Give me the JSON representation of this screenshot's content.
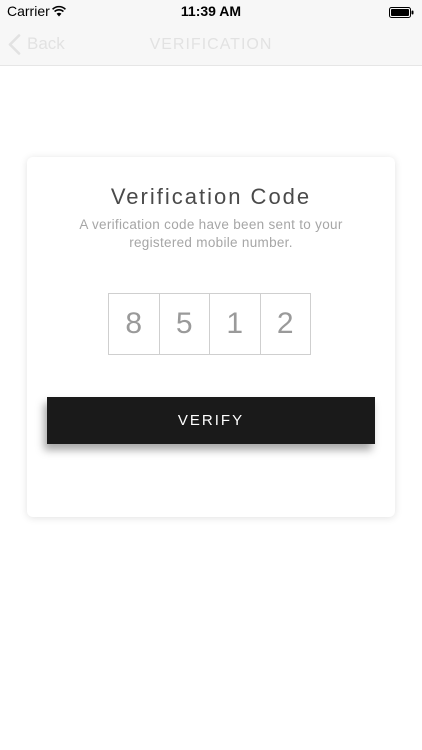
{
  "status_bar": {
    "carrier": "Carrier",
    "time": "11:39 AM",
    "wifi_icon": "wifi-icon",
    "battery_icon": "battery-icon"
  },
  "nav_bar": {
    "back_label": "Back",
    "back_icon": "chevron-left-icon",
    "title": "VERIFICATION"
  },
  "card": {
    "title": "Verification Code",
    "subtitle": "A verification code have been sent to your registered mobile number.",
    "code_digits": [
      "8",
      "5",
      "1",
      "2"
    ],
    "verify_label": "VERIFY"
  },
  "colors": {
    "button_background": "#1a1a1a",
    "nav_text": "#e2e2e2",
    "subtitle_text": "#a6a6a6"
  }
}
